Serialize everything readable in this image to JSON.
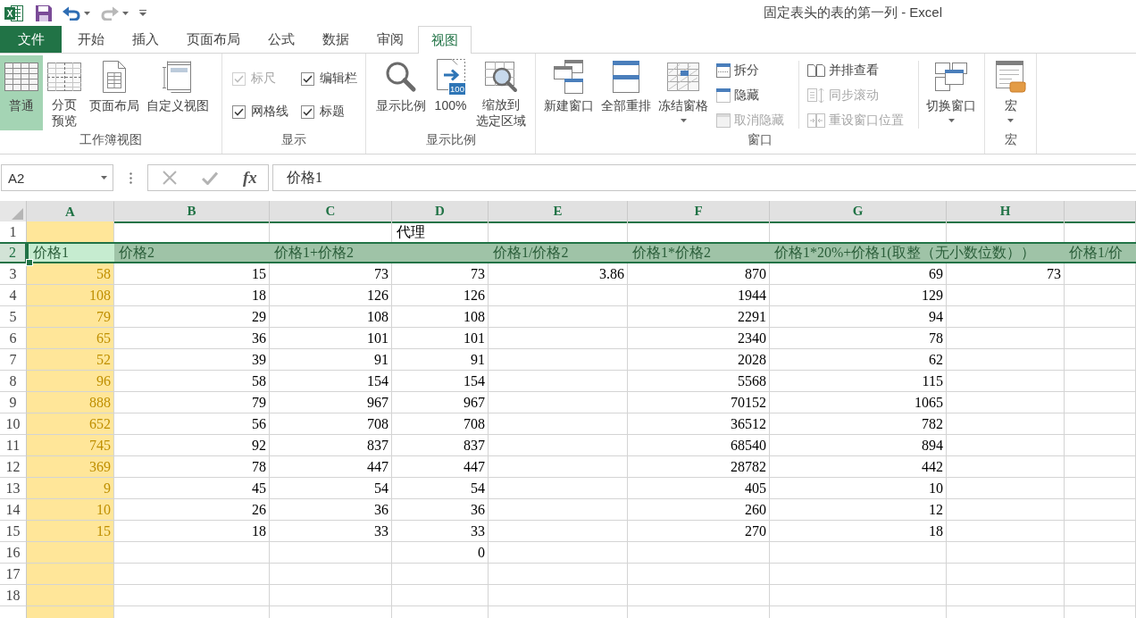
{
  "window": {
    "title": "固定表头的表的第一列 - Excel"
  },
  "quick_access": [
    {
      "kind": "logo",
      "letter": "X"
    },
    {
      "kind": "save"
    },
    {
      "kind": "undo",
      "dropdown": true,
      "disabled": false
    },
    {
      "kind": "redo",
      "dropdown": true,
      "disabled": true
    },
    {
      "kind": "customize"
    }
  ],
  "tabs": [
    {
      "label": "文件",
      "kind": "file",
      "selected": false
    },
    {
      "label": "开始",
      "kind": "tab",
      "selected": false
    },
    {
      "label": "插入",
      "kind": "tab",
      "selected": false
    },
    {
      "label": "页面布局",
      "kind": "tab",
      "selected": false
    },
    {
      "label": "公式",
      "kind": "tab",
      "selected": false
    },
    {
      "label": "数据",
      "kind": "tab",
      "selected": false
    },
    {
      "label": "审阅",
      "kind": "tab",
      "selected": false
    },
    {
      "label": "视图",
      "kind": "tab",
      "selected": true
    }
  ],
  "ribbon": {
    "groups": [
      {
        "label": "工作簿视图",
        "items": [
          {
            "kind": "large",
            "label": "普通",
            "selected": true
          },
          {
            "kind": "large",
            "lines": [
              "分页",
              "预览"
            ],
            "selected": false
          },
          {
            "kind": "large",
            "label": "页面布局",
            "selected": false
          },
          {
            "kind": "large",
            "label": "自定义视图",
            "selected": false
          }
        ]
      },
      {
        "label": "显示",
        "items": [
          {
            "kind": "checkbox",
            "label": "标尺",
            "checked": true,
            "disabled": true
          },
          {
            "kind": "checkbox",
            "label": "编辑栏",
            "checked": true,
            "disabled": false
          },
          {
            "kind": "checkbox",
            "label": "网格线",
            "checked": true,
            "disabled": false
          },
          {
            "kind": "checkbox",
            "label": "标题",
            "checked": true,
            "disabled": false
          }
        ]
      },
      {
        "label": "显示比例",
        "items": [
          {
            "kind": "large",
            "label": "显示比例"
          },
          {
            "kind": "large",
            "label": "100%",
            "badge": "100"
          },
          {
            "kind": "large",
            "lines": [
              "缩放到",
              "选定区域"
            ]
          }
        ]
      },
      {
        "label": "窗口",
        "items": [
          {
            "kind": "large",
            "label": "新建窗口"
          },
          {
            "kind": "large",
            "label": "全部重排"
          },
          {
            "kind": "large",
            "label": "冻结窗格",
            "dropdown": true
          },
          {
            "kind": "small",
            "label": "拆分",
            "disabled": false
          },
          {
            "kind": "small",
            "label": "隐藏",
            "disabled": false
          },
          {
            "kind": "small",
            "label": "取消隐藏",
            "disabled": true
          },
          {
            "kind": "small",
            "label": "并排查看",
            "disabled": false
          },
          {
            "kind": "small",
            "label": "同步滚动",
            "disabled": true
          },
          {
            "kind": "small",
            "label": "重设窗口位置",
            "disabled": true
          },
          {
            "kind": "large",
            "label": "切换窗口",
            "dropdown": true
          }
        ]
      },
      {
        "label": "宏",
        "items": [
          {
            "kind": "large",
            "label": "宏",
            "dropdown": true
          }
        ]
      }
    ]
  },
  "formula_bar": {
    "name_box": "A2",
    "buttons": [
      {
        "kind": "cancel",
        "disabled": true
      },
      {
        "kind": "enter",
        "disabled": true
      }
    ],
    "function_label": "fx",
    "value": "价格1"
  },
  "sheet": {
    "columns": [
      {
        "label": "A",
        "highlighted": true
      },
      {
        "label": "B",
        "highlighted": false
      },
      {
        "label": "C",
        "highlighted": false
      },
      {
        "label": "D",
        "highlighted": false
      },
      {
        "label": "E",
        "highlighted": false
      },
      {
        "label": "F",
        "highlighted": false
      },
      {
        "label": "G",
        "highlighted": false
      },
      {
        "label": "H",
        "highlighted": false
      },
      {
        "highlighted": false
      }
    ],
    "rows": [
      {
        "number": "1",
        "kind": "label",
        "selected": false,
        "cells": {
          "d": "代理"
        }
      },
      {
        "number": "2",
        "kind": "label",
        "selected": true,
        "cells": {
          "a": "价格1",
          "b": "价格2",
          "c": "价格1+价格2",
          "e": "价格1/价格2",
          "f": "价格1*价格2",
          "g": "价格1*20%+价格1(取整（无小数位数））",
          "i": "价格1/价"
        }
      },
      {
        "number": "3",
        "kind": "values",
        "selected": false,
        "cells": {
          "a": "58",
          "b": "15",
          "c": "73",
          "d": "73",
          "e": "3.86",
          "f": "870",
          "g": "69",
          "h": "73"
        }
      },
      {
        "number": "4",
        "kind": "values",
        "selected": false,
        "cells": {
          "a": "108",
          "b": "18",
          "c": "126",
          "d": "126",
          "f": "1944",
          "g": "129"
        }
      },
      {
        "number": "5",
        "kind": "values",
        "selected": false,
        "cells": {
          "a": "79",
          "b": "29",
          "c": "108",
          "d": "108",
          "f": "2291",
          "g": "94"
        }
      },
      {
        "number": "6",
        "kind": "values",
        "selected": false,
        "cells": {
          "a": "65",
          "b": "36",
          "c": "101",
          "d": "101",
          "f": "2340",
          "g": "78"
        }
      },
      {
        "number": "7",
        "kind": "values",
        "selected": false,
        "cells": {
          "a": "52",
          "b": "39",
          "c": "91",
          "d": "91",
          "f": "2028",
          "g": "62"
        }
      },
      {
        "number": "8",
        "kind": "values",
        "selected": false,
        "cells": {
          "a": "96",
          "b": "58",
          "c": "154",
          "d": "154",
          "f": "5568",
          "g": "115"
        }
      },
      {
        "number": "9",
        "kind": "values",
        "selected": false,
        "cells": {
          "a": "888",
          "b": "79",
          "c": "967",
          "d": "967",
          "f": "70152",
          "g": "1065"
        }
      },
      {
        "number": "10",
        "kind": "values",
        "selected": false,
        "cells": {
          "a": "652",
          "b": "56",
          "c": "708",
          "d": "708",
          "f": "36512",
          "g": "782"
        }
      },
      {
        "number": "11",
        "kind": "values",
        "selected": false,
        "cells": {
          "a": "745",
          "b": "92",
          "c": "837",
          "d": "837",
          "f": "68540",
          "g": "894"
        }
      },
      {
        "number": "12",
        "kind": "values",
        "selected": false,
        "cells": {
          "a": "369",
          "b": "78",
          "c": "447",
          "d": "447",
          "f": "28782",
          "g": "442"
        }
      },
      {
        "number": "13",
        "kind": "values",
        "selected": false,
        "cells": {
          "a": "9",
          "b": "45",
          "c": "54",
          "d": "54",
          "f": "405",
          "g": "10"
        }
      },
      {
        "number": "14",
        "kind": "values",
        "selected": false,
        "cells": {
          "a": "10",
          "b": "26",
          "c": "36",
          "d": "36",
          "f": "260",
          "g": "12"
        }
      },
      {
        "number": "15",
        "kind": "values",
        "selected": false,
        "cells": {
          "a": "15",
          "b": "18",
          "c": "33",
          "d": "33",
          "f": "270",
          "g": "18"
        }
      },
      {
        "number": "16",
        "kind": "values",
        "selected": false,
        "cells": {
          "d": "0"
        }
      },
      {
        "number": "17",
        "kind": "values",
        "selected": false
      },
      {
        "number": "18",
        "kind": "values",
        "selected": false
      }
    ]
  }
}
